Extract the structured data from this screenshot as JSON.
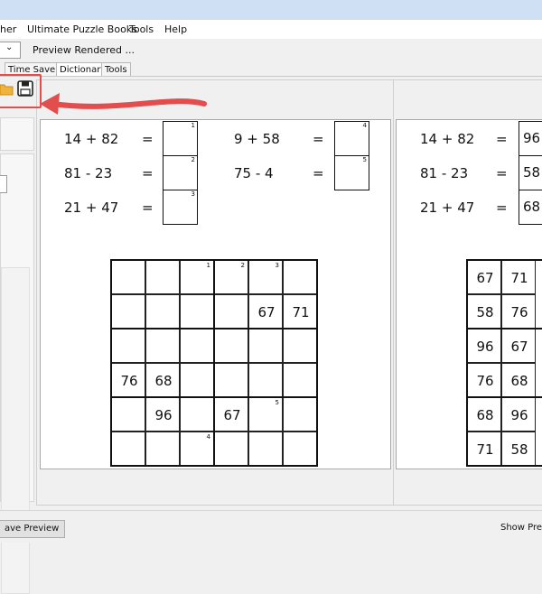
{
  "menu": [
    "her",
    "Ultimate Puzzle Books",
    "Tools",
    "Help"
  ],
  "toolbar": {
    "preview_label": "Preview Rendered ..."
  },
  "tabs": [
    "Time Saver",
    "Dictionary",
    "Tools"
  ],
  "left_preview": {
    "equations": [
      {
        "expr": "14 + 82",
        "eq": "=",
        "index": "1"
      },
      {
        "expr": "81 - 23",
        "eq": "=",
        "index": "2"
      },
      {
        "expr": "21 + 47",
        "eq": "=",
        "index": "3"
      },
      {
        "expr": "9 + 58",
        "eq": "=",
        "index": "4"
      },
      {
        "expr": "75 - 4",
        "eq": "=",
        "index": "5"
      }
    ],
    "grid": [
      [
        "",
        "",
        "",
        "",
        "",
        ""
      ],
      [
        "",
        "",
        "",
        "",
        "67",
        "71"
      ],
      [
        "",
        "",
        "",
        "",
        "",
        ""
      ],
      [
        "76",
        "68",
        "",
        "",
        "",
        ""
      ],
      [
        "",
        "96",
        "",
        "67",
        "",
        ""
      ],
      [
        "",
        "",
        "",
        "",
        "",
        ""
      ]
    ],
    "grid_indices": [
      {
        "row": 0,
        "col": 2,
        "label": "1"
      },
      {
        "row": 0,
        "col": 3,
        "label": "2"
      },
      {
        "row": 0,
        "col": 4,
        "label": "3"
      },
      {
        "row": 4,
        "col": 4,
        "label": "5"
      },
      {
        "row": 5,
        "col": 2,
        "label": "4"
      }
    ]
  },
  "right_preview": {
    "equations": [
      {
        "expr": "14 + 82",
        "eq": "=",
        "answer": "96"
      },
      {
        "expr": "81 - 23",
        "eq": "=",
        "answer": "58"
      },
      {
        "expr": "21 + 47",
        "eq": "=",
        "answer": "68"
      }
    ],
    "grid": [
      [
        "67",
        "71"
      ],
      [
        "58",
        "76"
      ],
      [
        "96",
        "67"
      ],
      [
        "76",
        "68"
      ],
      [
        "68",
        "96"
      ],
      [
        "71",
        "58"
      ]
    ]
  },
  "bottom": {
    "left_button": "ave Preview",
    "right_button": "Show Previ"
  },
  "colors": {
    "highlight": "#e24d4d",
    "folder": "#f2b33d"
  }
}
